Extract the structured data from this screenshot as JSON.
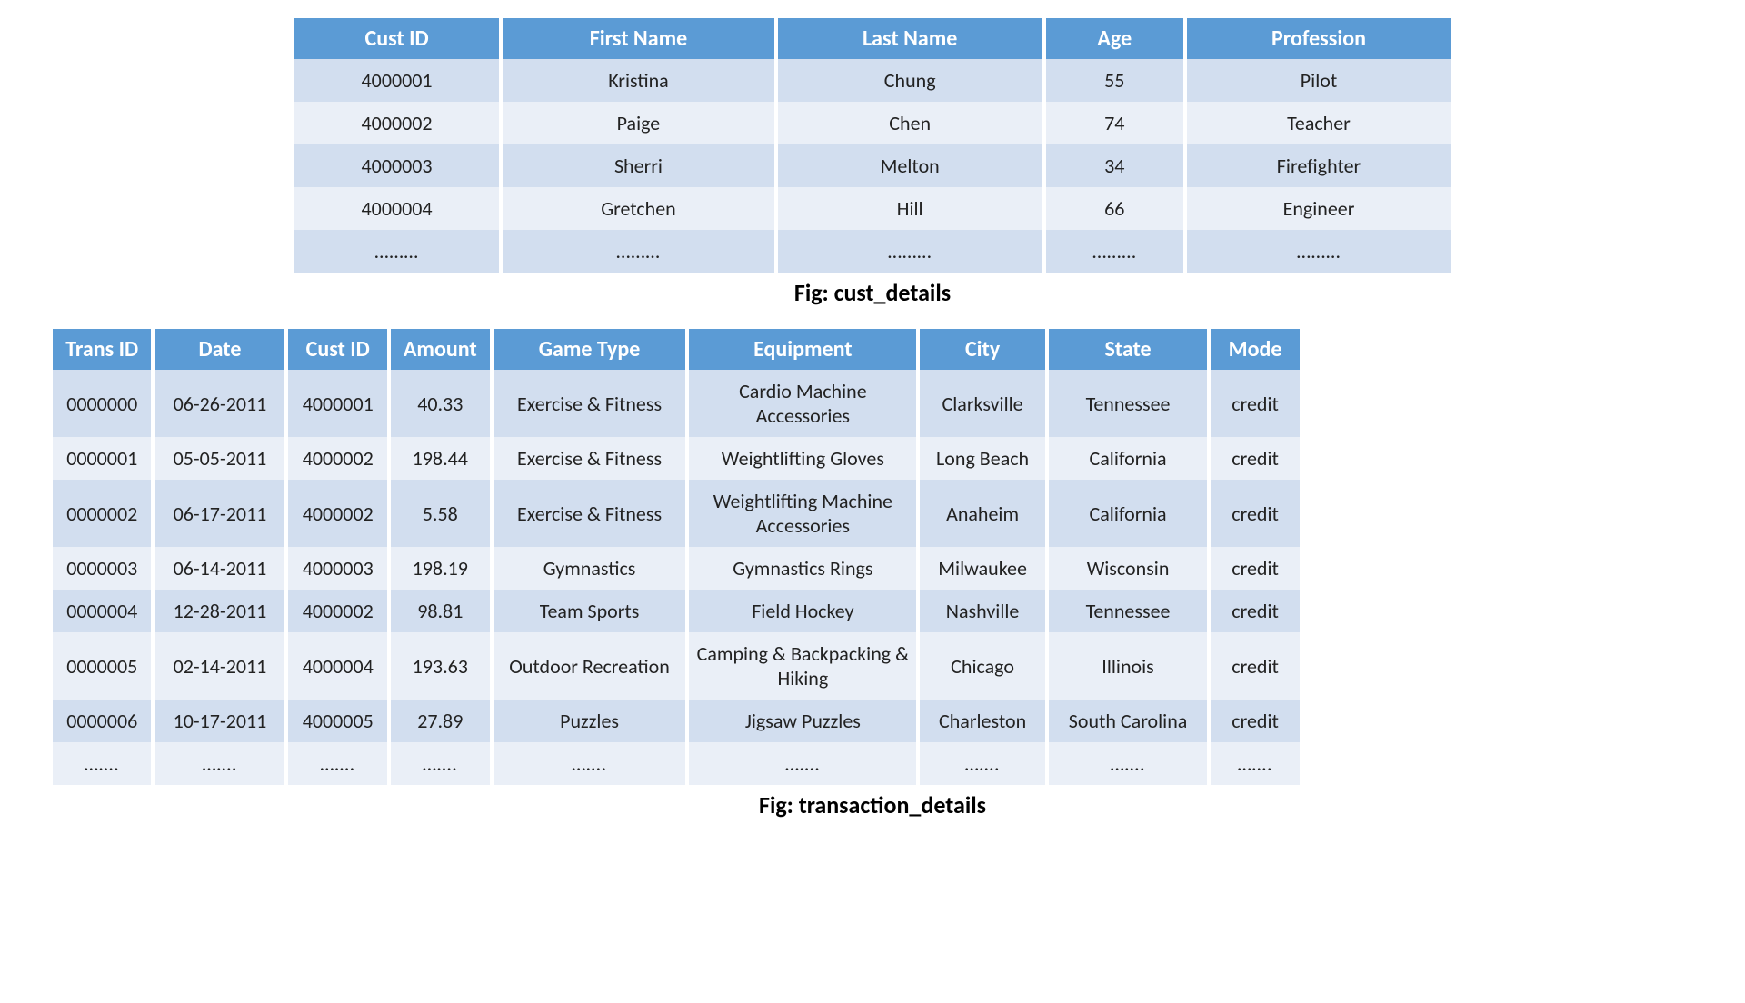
{
  "table1": {
    "caption": "Fig: cust_details",
    "headers": [
      "Cust ID",
      "First Name",
      "Last Name",
      "Age",
      "Profession"
    ],
    "rows": [
      [
        "4000001",
        "Kristina",
        "Chung",
        "55",
        "Pilot"
      ],
      [
        "4000002",
        "Paige",
        "Chen",
        "74",
        "Teacher"
      ],
      [
        "4000003",
        "Sherri",
        "Melton",
        "34",
        "Firefighter"
      ],
      [
        "4000004",
        "Gretchen",
        "Hill",
        "66",
        "Engineer"
      ],
      [
        "………",
        "………",
        "………",
        "………",
        "………"
      ]
    ]
  },
  "table2": {
    "caption": "Fig: transaction_details",
    "headers": [
      "Trans ID",
      "Date",
      "Cust ID",
      "Amount",
      "Game Type",
      "Equipment",
      "City",
      "State",
      "Mode"
    ],
    "rows": [
      [
        "0000000",
        "06-26-2011",
        "4000001",
        "40.33",
        "Exercise & Fitness",
        "Cardio Machine Accessories",
        "Clarksville",
        "Tennessee",
        "credit"
      ],
      [
        "0000001",
        "05-05-2011",
        "4000002",
        "198.44",
        "Exercise & Fitness",
        "Weightlifting Gloves",
        "Long Beach",
        "California",
        "credit"
      ],
      [
        "0000002",
        "06-17-2011",
        "4000002",
        "5.58",
        "Exercise & Fitness",
        "Weightlifting Machine Accessories",
        "Anaheim",
        "California",
        "credit"
      ],
      [
        "0000003",
        "06-14-2011",
        "4000003",
        "198.19",
        "Gymnastics",
        "Gymnastics Rings",
        "Milwaukee",
        "Wisconsin",
        "credit"
      ],
      [
        "0000004",
        "12-28-2011",
        "4000002",
        "98.81",
        "Team Sports",
        "Field Hockey",
        "Nashville",
        "Tennessee",
        "credit"
      ],
      [
        "0000005",
        "02-14-2011",
        "4000004",
        "193.63",
        "Outdoor Recreation",
        "Camping & Backpacking & Hiking",
        "Chicago",
        "Illinois",
        "credit"
      ],
      [
        "0000006",
        "10-17-2011",
        "4000005",
        "27.89",
        "Puzzles",
        "Jigsaw Puzzles",
        "Charleston",
        "South Carolina",
        "credit"
      ],
      [
        "…….",
        "…….",
        "…….",
        "…….",
        "…….",
        "…….",
        "…….",
        "…….",
        "……."
      ]
    ]
  }
}
